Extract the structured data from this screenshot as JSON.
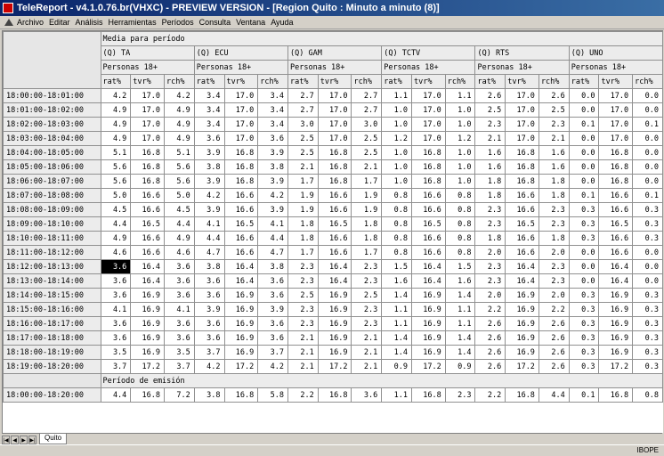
{
  "window": {
    "title": "TeleReport - v4.1.0.76.br(VHXC) - PREVIEW VERSION - [Region Quito : Minuto a minuto (8)]"
  },
  "menu": [
    "Archivo",
    "Editar",
    "Análisis",
    "Herramientas",
    "Períodos",
    "Consulta",
    "Ventana",
    "Ayuda"
  ],
  "table": {
    "section_title": "Media para período",
    "channels": [
      "(Q) TA",
      "(Q) ECU",
      "(Q) GAM",
      "(Q) TCTV",
      "(Q) RTS",
      "(Q) UNO"
    ],
    "target": "Personas 18+",
    "measures": [
      "rat%",
      "tvr%",
      "rch%"
    ],
    "rows": [
      {
        "label": "18:00:00-18:01:00",
        "values": [
          "4.2",
          "17.0",
          "4.2",
          "3.4",
          "17.0",
          "3.4",
          "2.7",
          "17.0",
          "2.7",
          "1.1",
          "17.0",
          "1.1",
          "2.6",
          "17.0",
          "2.6",
          "0.0",
          "17.0",
          "0.0"
        ]
      },
      {
        "label": "18:01:00-18:02:00",
        "values": [
          "4.9",
          "17.0",
          "4.9",
          "3.4",
          "17.0",
          "3.4",
          "2.7",
          "17.0",
          "2.7",
          "1.0",
          "17.0",
          "1.0",
          "2.5",
          "17.0",
          "2.5",
          "0.0",
          "17.0",
          "0.0"
        ]
      },
      {
        "label": "18:02:00-18:03:00",
        "values": [
          "4.9",
          "17.0",
          "4.9",
          "3.4",
          "17.0",
          "3.4",
          "3.0",
          "17.0",
          "3.0",
          "1.0",
          "17.0",
          "1.0",
          "2.3",
          "17.0",
          "2.3",
          "0.1",
          "17.0",
          "0.1"
        ]
      },
      {
        "label": "18:03:00-18:04:00",
        "values": [
          "4.9",
          "17.0",
          "4.9",
          "3.6",
          "17.0",
          "3.6",
          "2.5",
          "17.0",
          "2.5",
          "1.2",
          "17.0",
          "1.2",
          "2.1",
          "17.0",
          "2.1",
          "0.0",
          "17.0",
          "0.0"
        ]
      },
      {
        "label": "18:04:00-18:05:00",
        "values": [
          "5.1",
          "16.8",
          "5.1",
          "3.9",
          "16.8",
          "3.9",
          "2.5",
          "16.8",
          "2.5",
          "1.0",
          "16.8",
          "1.0",
          "1.6",
          "16.8",
          "1.6",
          "0.0",
          "16.8",
          "0.0"
        ]
      },
      {
        "label": "18:05:00-18:06:00",
        "values": [
          "5.6",
          "16.8",
          "5.6",
          "3.8",
          "16.8",
          "3.8",
          "2.1",
          "16.8",
          "2.1",
          "1.0",
          "16.8",
          "1.0",
          "1.6",
          "16.8",
          "1.6",
          "0.0",
          "16.8",
          "0.0"
        ]
      },
      {
        "label": "18:06:00-18:07:00",
        "values": [
          "5.6",
          "16.8",
          "5.6",
          "3.9",
          "16.8",
          "3.9",
          "1.7",
          "16.8",
          "1.7",
          "1.0",
          "16.8",
          "1.0",
          "1.8",
          "16.8",
          "1.8",
          "0.0",
          "16.8",
          "0.0"
        ]
      },
      {
        "label": "18:07:00-18:08:00",
        "values": [
          "5.0",
          "16.6",
          "5.0",
          "4.2",
          "16.6",
          "4.2",
          "1.9",
          "16.6",
          "1.9",
          "0.8",
          "16.6",
          "0.8",
          "1.8",
          "16.6",
          "1.8",
          "0.1",
          "16.6",
          "0.1"
        ]
      },
      {
        "label": "18:08:00-18:09:00",
        "values": [
          "4.5",
          "16.6",
          "4.5",
          "3.9",
          "16.6",
          "3.9",
          "1.9",
          "16.6",
          "1.9",
          "0.8",
          "16.6",
          "0.8",
          "2.3",
          "16.6",
          "2.3",
          "0.3",
          "16.6",
          "0.3"
        ]
      },
      {
        "label": "18:09:00-18:10:00",
        "values": [
          "4.4",
          "16.5",
          "4.4",
          "4.1",
          "16.5",
          "4.1",
          "1.8",
          "16.5",
          "1.8",
          "0.8",
          "16.5",
          "0.8",
          "2.3",
          "16.5",
          "2.3",
          "0.3",
          "16.5",
          "0.3"
        ]
      },
      {
        "label": "18:10:00-18:11:00",
        "values": [
          "4.9",
          "16.6",
          "4.9",
          "4.4",
          "16.6",
          "4.4",
          "1.8",
          "16.6",
          "1.8",
          "0.8",
          "16.6",
          "0.8",
          "1.8",
          "16.6",
          "1.8",
          "0.3",
          "16.6",
          "0.3"
        ]
      },
      {
        "label": "18:11:00-18:12:00",
        "values": [
          "4.6",
          "16.6",
          "4.6",
          "4.7",
          "16.6",
          "4.7",
          "1.7",
          "16.6",
          "1.7",
          "0.8",
          "16.6",
          "0.8",
          "2.0",
          "16.6",
          "2.0",
          "0.0",
          "16.6",
          "0.0"
        ]
      },
      {
        "label": "18:12:00-18:13:00",
        "values": [
          "3.6",
          "16.4",
          "3.6",
          "3.8",
          "16.4",
          "3.8",
          "2.3",
          "16.4",
          "2.3",
          "1.5",
          "16.4",
          "1.5",
          "2.3",
          "16.4",
          "2.3",
          "0.0",
          "16.4",
          "0.0"
        ]
      },
      {
        "label": "18:13:00-18:14:00",
        "values": [
          "3.6",
          "16.4",
          "3.6",
          "3.6",
          "16.4",
          "3.6",
          "2.3",
          "16.4",
          "2.3",
          "1.6",
          "16.4",
          "1.6",
          "2.3",
          "16.4",
          "2.3",
          "0.0",
          "16.4",
          "0.0"
        ]
      },
      {
        "label": "18:14:00-18:15:00",
        "values": [
          "3.6",
          "16.9",
          "3.6",
          "3.6",
          "16.9",
          "3.6",
          "2.5",
          "16.9",
          "2.5",
          "1.4",
          "16.9",
          "1.4",
          "2.0",
          "16.9",
          "2.0",
          "0.3",
          "16.9",
          "0.3"
        ]
      },
      {
        "label": "18:15:00-18:16:00",
        "values": [
          "4.1",
          "16.9",
          "4.1",
          "3.9",
          "16.9",
          "3.9",
          "2.3",
          "16.9",
          "2.3",
          "1.1",
          "16.9",
          "1.1",
          "2.2",
          "16.9",
          "2.2",
          "0.3",
          "16.9",
          "0.3"
        ]
      },
      {
        "label": "18:16:00-18:17:00",
        "values": [
          "3.6",
          "16.9",
          "3.6",
          "3.6",
          "16.9",
          "3.6",
          "2.3",
          "16.9",
          "2.3",
          "1.1",
          "16.9",
          "1.1",
          "2.6",
          "16.9",
          "2.6",
          "0.3",
          "16.9",
          "0.3"
        ]
      },
      {
        "label": "18:17:00-18:18:00",
        "values": [
          "3.6",
          "16.9",
          "3.6",
          "3.6",
          "16.9",
          "3.6",
          "2.1",
          "16.9",
          "2.1",
          "1.4",
          "16.9",
          "1.4",
          "2.6",
          "16.9",
          "2.6",
          "0.3",
          "16.9",
          "0.3"
        ]
      },
      {
        "label": "18:18:00-18:19:00",
        "values": [
          "3.5",
          "16.9",
          "3.5",
          "3.7",
          "16.9",
          "3.7",
          "2.1",
          "16.9",
          "2.1",
          "1.4",
          "16.9",
          "1.4",
          "2.6",
          "16.9",
          "2.6",
          "0.3",
          "16.9",
          "0.3"
        ]
      },
      {
        "label": "18:19:00-18:20:00",
        "values": [
          "3.7",
          "17.2",
          "3.7",
          "4.2",
          "17.2",
          "4.2",
          "2.1",
          "17.2",
          "2.1",
          "0.9",
          "17.2",
          "0.9",
          "2.6",
          "17.2",
          "2.6",
          "0.3",
          "17.2",
          "0.3"
        ]
      }
    ],
    "summary_title": "Período de emisión",
    "summary_row": {
      "label": "18:00:00-18:20:00",
      "values": [
        "4.4",
        "16.8",
        "7.2",
        "3.8",
        "16.8",
        "5.8",
        "2.2",
        "16.8",
        "3.6",
        "1.1",
        "16.8",
        "2.3",
        "2.2",
        "16.8",
        "4.4",
        "0.1",
        "16.8",
        "0.8"
      ]
    },
    "selected_cell": {
      "row": 12,
      "col": 0
    }
  },
  "sheet_tab": "Quito",
  "status": {
    "brand": "IBOPE"
  }
}
